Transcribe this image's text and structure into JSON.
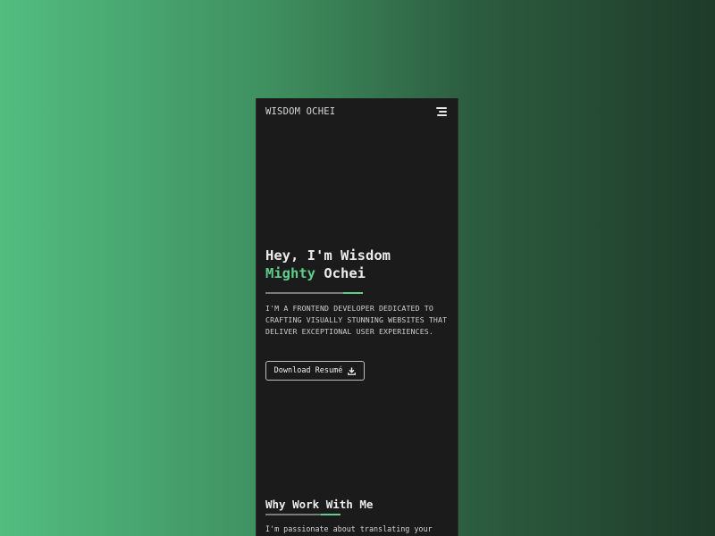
{
  "header": {
    "brand": "WISDOM OCHEI",
    "menu_icon": "hamburger-menu-icon"
  },
  "hero": {
    "title_line1": "Hey, I'm Wisdom",
    "title_accent": "Mighty",
    "title_rest": " Ochei",
    "description": "I'M A FRONTEND DEVELOPER DEDICATED TO CRAFTING VISUALLY STUNNING WEBSITES THAT DELIVER EXCEPTIONAL USER EXPERIENCES.",
    "download_label": "Download Resumé",
    "download_icon": "download-icon"
  },
  "why": {
    "title": "Why Work With Me",
    "text": "I'm passionate about translating your"
  },
  "colors": {
    "accent": "#5fce8a",
    "panel": "#1b1b1b",
    "gradient_left": "#52bd80",
    "gradient_right": "#1f3a29"
  }
}
